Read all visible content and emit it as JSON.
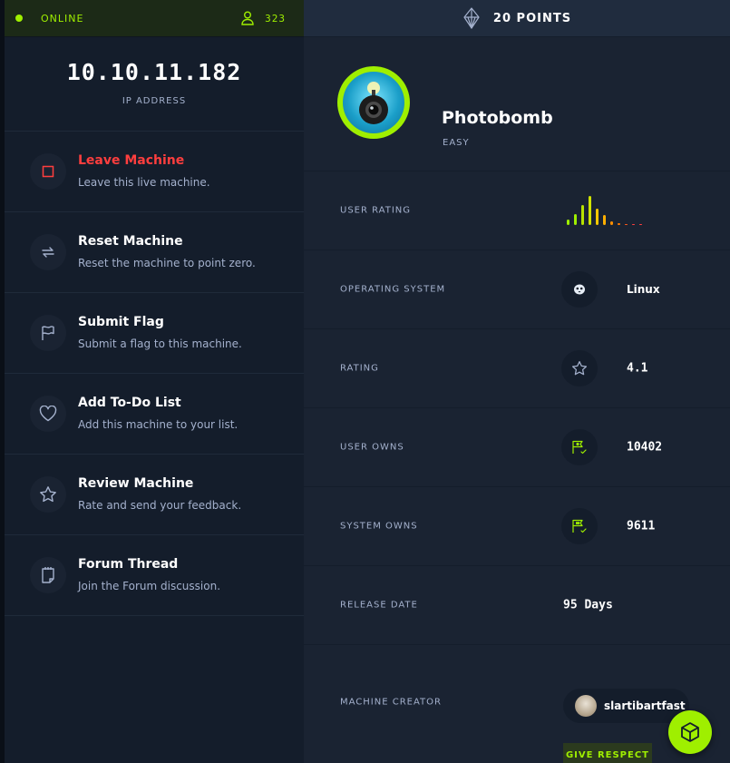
{
  "status": {
    "label": "ONLINE",
    "user_count": "323"
  },
  "ip": {
    "value": "10.10.11.182",
    "label": "IP ADDRESS"
  },
  "actions": [
    {
      "title": "Leave Machine",
      "desc": "Leave this live machine.",
      "icon": "stop-square-icon",
      "title_color": "#ff3e3e"
    },
    {
      "title": "Reset Machine",
      "desc": "Reset the machine to point zero.",
      "icon": "reset-arrows-icon",
      "title_color": "#ffffff"
    },
    {
      "title": "Submit Flag",
      "desc": "Submit a flag to this machine.",
      "icon": "flag-icon",
      "title_color": "#ffffff"
    },
    {
      "title": "Add To-Do List",
      "desc": "Add this machine to your list.",
      "icon": "heart-icon",
      "title_color": "#ffffff"
    },
    {
      "title": "Review Machine",
      "desc": "Rate and send your feedback.",
      "icon": "star-icon",
      "title_color": "#ffffff"
    },
    {
      "title": "Forum Thread",
      "desc": "Join the Forum discussion.",
      "icon": "notepad-icon",
      "title_color": "#ffffff"
    }
  ],
  "points": {
    "label": "20 POINTS",
    "icon": "diamond-icon"
  },
  "machine": {
    "name": "Photobomb",
    "difficulty": "EASY"
  },
  "details": {
    "user_rating_label": "USER RATING",
    "os_label": "OPERATING SYSTEM",
    "os_value": "Linux",
    "os_icon": "linux-penguin-icon",
    "rating_label": "RATING",
    "rating_value": "4.1",
    "rating_icon": "star-icon",
    "user_owns_label": "USER OWNS",
    "user_owns_value": "10402",
    "user_owns_icon": "user-flag-icon",
    "system_owns_label": "SYSTEM OWNS",
    "system_owns_value": "9611",
    "system_owns_icon": "system-flag-icon",
    "release_label": "RELEASE DATE",
    "release_value": "95 Days",
    "creator_label": "MACHINE CREATOR",
    "creator_name": "slartibartfast",
    "respect_label": "GIVE RESPECT"
  },
  "colors": {
    "accent": "#9fef00",
    "danger": "#ff3e3e",
    "panel_left": "#141d2b",
    "panel_right": "#1a2332"
  }
}
